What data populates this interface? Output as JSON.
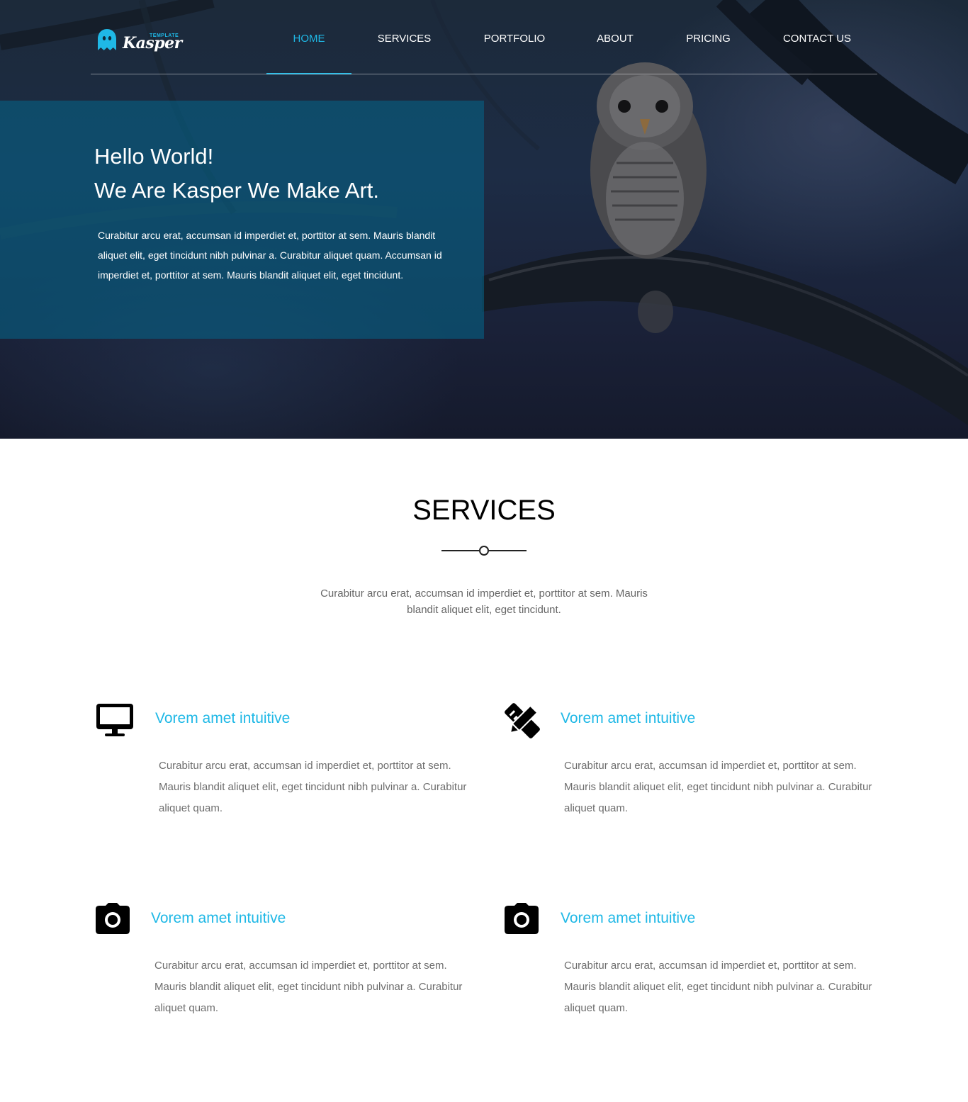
{
  "header": {
    "logo_small": "TEMPLATE",
    "logo_text": "Kasper",
    "nav": [
      {
        "label": "HOME",
        "active": true
      },
      {
        "label": "SERVICES",
        "active": false
      },
      {
        "label": "PORTFOLIO",
        "active": false
      },
      {
        "label": "ABOUT",
        "active": false
      },
      {
        "label": "PRICING",
        "active": false
      },
      {
        "label": "CONTACT US",
        "active": false
      }
    ]
  },
  "hero": {
    "title_line1": "Hello World!",
    "title_line2": "We Are Kasper We Make Art.",
    "text": "Curabitur arcu erat, accumsan id imperdiet et, porttitor at sem. Mauris blandit aliquet elit, eget tincidunt nibh pulvinar a. Curabitur aliquet quam. Accumsan id imperdiet et, porttitor at sem. Mauris blandit aliquet elit, eget tincidunt."
  },
  "services": {
    "title": "SERVICES",
    "description": "Curabitur arcu erat, accumsan id imperdiet et, porttitor at sem. Mauris blandit aliquet elit, eget tincidunt.",
    "items": [
      {
        "icon": "desktop-icon",
        "title": "Vorem amet intuitive",
        "text": "Curabitur arcu erat, accumsan id imperdiet et, porttitor at sem. Mauris blandit aliquet elit, eget tincidunt nibh pulvinar a. Curabitur aliquet quam."
      },
      {
        "icon": "pencil-ruler-icon",
        "title": "Vorem amet intuitive",
        "text": "Curabitur arcu erat, accumsan id imperdiet et, porttitor at sem. Mauris blandit aliquet elit, eget tincidunt nibh pulvinar a. Curabitur aliquet quam."
      },
      {
        "icon": "camera-icon",
        "title": "Vorem amet intuitive",
        "text": "Curabitur arcu erat, accumsan id imperdiet et, porttitor at sem. Mauris blandit aliquet elit, eget tincidunt nibh pulvinar a. Curabitur aliquet quam."
      },
      {
        "icon": "camera-icon",
        "title": "Vorem amet intuitive",
        "text": "Curabitur arcu erat, accumsan id imperdiet et, porttitor at sem. Mauris blandit aliquet elit, eget tincidunt nibh pulvinar a. Curabitur aliquet quam."
      }
    ]
  },
  "colors": {
    "accent": "#1fb8e6",
    "intro_box": "#066082",
    "body_text": "#6d6d6d"
  }
}
